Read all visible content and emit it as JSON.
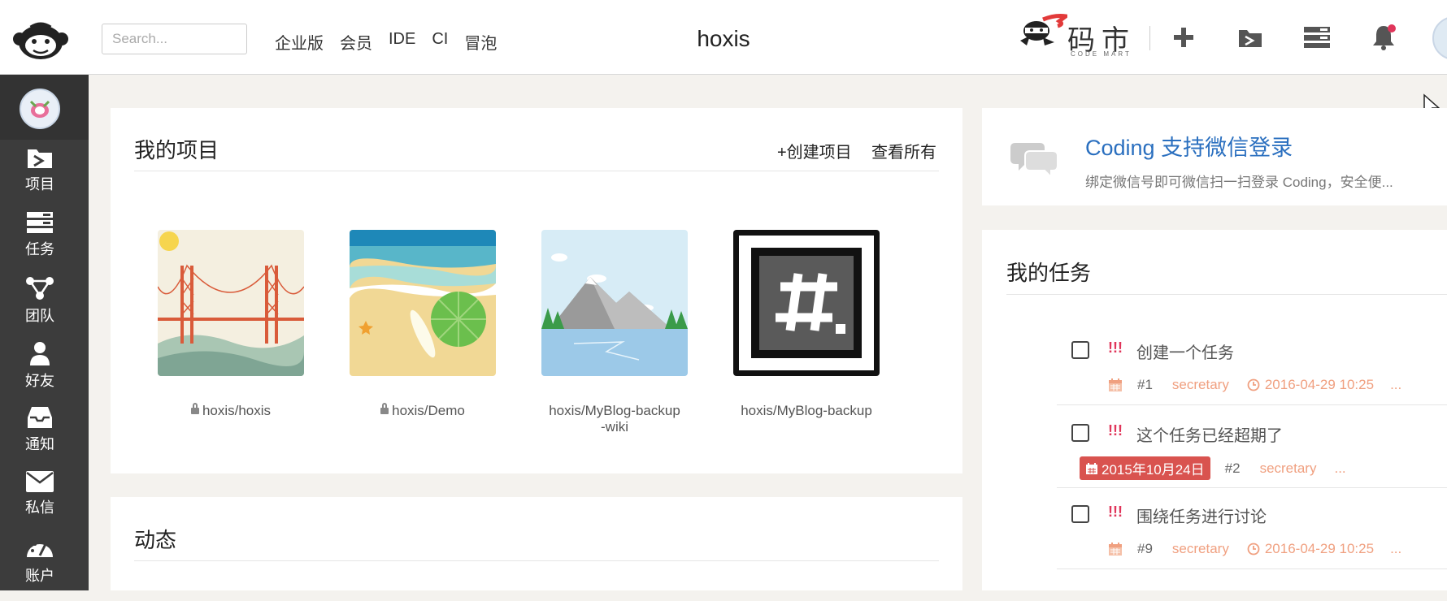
{
  "header": {
    "search_placeholder": "Search...",
    "nav": [
      "企业版",
      "会员",
      "IDE",
      "CI",
      "冒泡"
    ],
    "title": "hoxis",
    "codemart_text": "码市",
    "codemart_sub": "CODE MART",
    "icons": [
      "plus-icon",
      "folder-icon",
      "tasks-icon",
      "bell-icon"
    ],
    "notification_dot_color": "#e0355a"
  },
  "sidebar": {
    "items": [
      {
        "label": "项目",
        "icon": "project-folder-icon"
      },
      {
        "label": "任务",
        "icon": "task-list-icon"
      },
      {
        "label": "团队",
        "icon": "team-icon"
      },
      {
        "label": "好友",
        "icon": "friend-icon"
      },
      {
        "label": "通知",
        "icon": "inbox-icon"
      },
      {
        "label": "私信",
        "icon": "envelope-icon"
      },
      {
        "label": "账户",
        "icon": "dashboard-icon"
      }
    ]
  },
  "projects": {
    "title": "我的项目",
    "create_label": "+创建项目",
    "view_all_label": "查看所有",
    "items": [
      {
        "name": "hoxis/hoxis",
        "private": true
      },
      {
        "name": "hoxis/Demo",
        "private": true
      },
      {
        "name": "hoxis/MyBlog-backup-wiki",
        "line1": "hoxis/MyBlog-backup",
        "line2": "-wiki",
        "private": false
      },
      {
        "name": "hoxis/MyBlog-backup",
        "private": false
      }
    ]
  },
  "activity": {
    "title": "动态"
  },
  "announcement": {
    "title": "Coding 支持微信登录",
    "text": "绑定微信号即可微信扫一扫登录 Coding，安全便..."
  },
  "tasks": {
    "title": "我的任务",
    "items": [
      {
        "priority": "!!!",
        "title": "创建一个任务",
        "number": "#1",
        "owner": "secretary",
        "time": "2016-04-29 10:25",
        "more": "...",
        "due": ""
      },
      {
        "priority": "!!!",
        "title": "这个任务已经超期了",
        "number": "#2",
        "owner": "secretary",
        "time": "",
        "more": "...",
        "due": "2015年10月24日"
      },
      {
        "priority": "!!!",
        "title": "围绕任务进行讨论",
        "number": "#9",
        "owner": "secretary",
        "time": "2016-04-29 10:25",
        "more": "...",
        "due": ""
      }
    ]
  },
  "colors": {
    "sidebar_bg": "#3c3c3c",
    "link_blue": "#2a6fbf",
    "priority_red": "#e0355a",
    "overdue_red": "#d9534f",
    "meta_orange": "#f0a080"
  }
}
